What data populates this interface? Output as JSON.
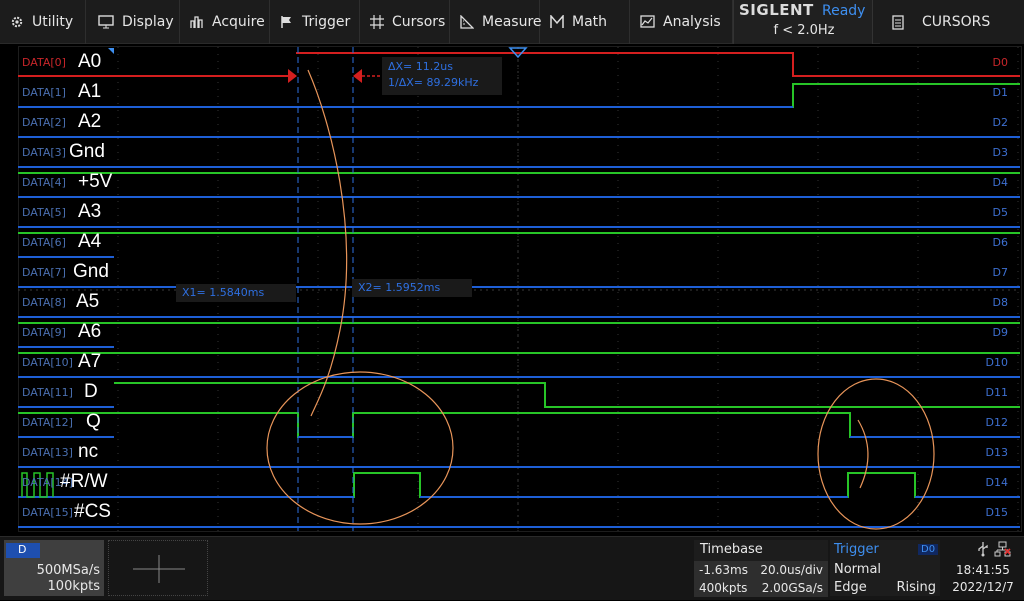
{
  "menu": {
    "items": [
      {
        "label": "Utility",
        "icon": "gear-icon"
      },
      {
        "label": "Display",
        "icon": "monitor-icon"
      },
      {
        "label": "Acquire",
        "icon": "acquire-icon"
      },
      {
        "label": "Trigger",
        "icon": "flag-icon"
      },
      {
        "label": "Cursors",
        "icon": "crosshair-icon"
      },
      {
        "label": "Measure",
        "icon": "ruler-icon"
      },
      {
        "label": "Math",
        "icon": "math-icon"
      },
      {
        "label": "Analysis",
        "icon": "analysis-icon"
      }
    ]
  },
  "status": {
    "brand": "SIGLENT",
    "state": "Ready",
    "freq": "f < 2.0Hz"
  },
  "cursors_button": {
    "label": "CURSORS",
    "icon": "document-icon"
  },
  "channels": [
    {
      "data": "DATA[0]",
      "pin": "A0",
      "d": "D0"
    },
    {
      "data": "DATA[1]",
      "pin": "A1",
      "d": "D1"
    },
    {
      "data": "DATA[2]",
      "pin": "A2",
      "d": "D2"
    },
    {
      "data": "DATA[3]",
      "pin": "Gnd",
      "d": "D3"
    },
    {
      "data": "DATA[4]",
      "pin": "+5V",
      "d": "D4"
    },
    {
      "data": "DATA[5]",
      "pin": "A3",
      "d": "D5"
    },
    {
      "data": "DATA[6]",
      "pin": "A4",
      "d": "D6"
    },
    {
      "data": "DATA[7]",
      "pin": "Gnd",
      "d": "D7"
    },
    {
      "data": "DATA[8]",
      "pin": "A5",
      "d": "D8"
    },
    {
      "data": "DATA[9]",
      "pin": "A6",
      "d": "D9"
    },
    {
      "data": "DATA[10]",
      "pin": "A7",
      "d": "D10"
    },
    {
      "data": "DATA[11]",
      "pin": "D",
      "d": "D11"
    },
    {
      "data": "DATA[12]",
      "pin": "Q",
      "d": "D12"
    },
    {
      "data": "DATA[13]",
      "pin": "nc",
      "d": "D13"
    },
    {
      "data": "DATA[14]",
      "pin": "#R/W",
      "d": "D14"
    },
    {
      "data": "DATA[15]",
      "pin": "#CS",
      "d": "D15"
    }
  ],
  "cursor_readout": {
    "dx": "ΔX= 11.2us",
    "inv_dx": "1/ΔX= 89.29kHz",
    "x1": "X1= 1.5840ms",
    "x2": "X2= 1.5952ms"
  },
  "acquisition": {
    "channel_tag": "D",
    "sample_rate": "500MSa/s",
    "points": "100kpts"
  },
  "timebase": {
    "title": "Timebase",
    "delay": "-1.63ms",
    "scale": "20.0us/div",
    "memory": "400kpts",
    "rate": "2.00GSa/s"
  },
  "trigger": {
    "title": "Trigger",
    "source": "D0",
    "mode": "Normal",
    "type": "Edge",
    "slope": "Rising"
  },
  "clock": {
    "time": "18:41:55",
    "date": "2022/12/7"
  },
  "colors": {
    "accent": "#3e8ff0",
    "trace_high": "#27c427",
    "trace_low": "#1e5fd6",
    "trigger_ch": "#d41f1f",
    "annotation": "#e8955a"
  }
}
